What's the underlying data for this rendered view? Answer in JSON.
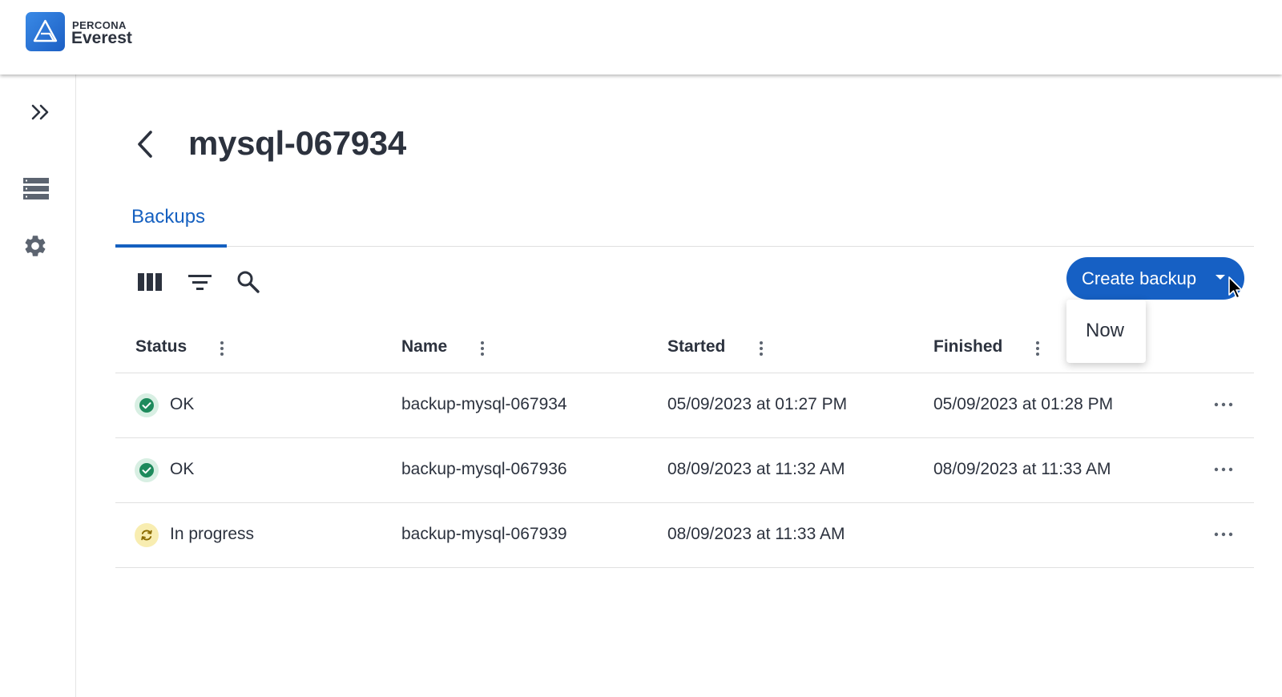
{
  "brand": {
    "company": "PERCONA",
    "product": "Everest",
    "accent": "#1660c4"
  },
  "sidebar": {
    "items": [
      {
        "icon": "double-chevron-right-icon",
        "label": "Expand menu"
      },
      {
        "icon": "databases-list-icon",
        "label": "Databases"
      },
      {
        "icon": "settings-gear-icon",
        "label": "Settings"
      }
    ]
  },
  "page": {
    "title": "mysql-067934",
    "back_icon": "chevron-left-icon"
  },
  "tabs": [
    {
      "label": "Backups",
      "active": true
    }
  ],
  "toolbar": {
    "tools": [
      "columns-icon",
      "filter-icon",
      "search-icon"
    ],
    "create_label": "Create backup",
    "dropdown_icon": "caret-down-icon"
  },
  "dropdown_menu": {
    "items": [
      {
        "label": "Now"
      }
    ]
  },
  "table": {
    "columns": [
      {
        "label": "Status"
      },
      {
        "label": "Name"
      },
      {
        "label": "Started"
      },
      {
        "label": "Finished"
      }
    ],
    "rows": [
      {
        "status": "OK",
        "status_kind": "ok",
        "name": "backup-mysql-067934",
        "started": "05/09/2023 at 01:27 PM",
        "finished": "05/09/2023 at 01:28 PM"
      },
      {
        "status": "OK",
        "status_kind": "ok",
        "name": "backup-mysql-067936",
        "started": "08/09/2023 at 11:32 AM",
        "finished": "08/09/2023 at 11:33 AM"
      },
      {
        "status": "In progress",
        "status_kind": "in-progress",
        "name": "backup-mysql-067939",
        "started": "08/09/2023 at 11:33 AM",
        "finished": ""
      }
    ]
  },
  "colors": {
    "ok": "#1e8a5c",
    "in_progress": "#b58a00",
    "text": "#2c323e"
  }
}
